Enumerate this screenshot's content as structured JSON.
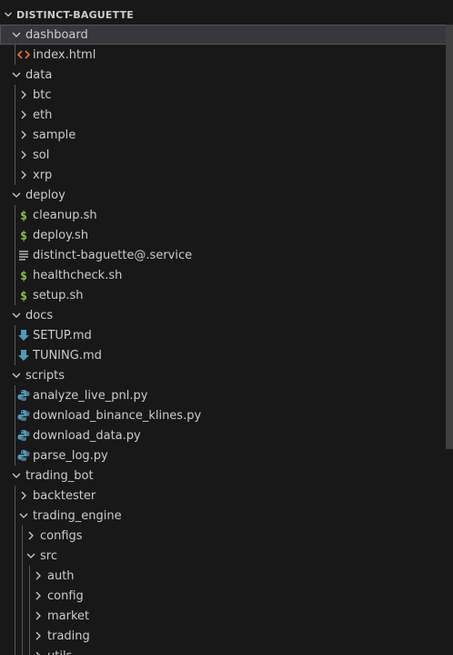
{
  "explorer": {
    "section_title": "DISTINCT-BAGUETTE",
    "tree": [
      {
        "label": "dashboard",
        "type": "folder",
        "expanded": true,
        "depth": 0,
        "selected": true
      },
      {
        "label": "index.html",
        "type": "file",
        "icon": "html-icon",
        "depth": 1
      },
      {
        "label": "data",
        "type": "folder",
        "expanded": true,
        "depth": 0
      },
      {
        "label": "btc",
        "type": "folder",
        "expanded": false,
        "depth": 1
      },
      {
        "label": "eth",
        "type": "folder",
        "expanded": false,
        "depth": 1
      },
      {
        "label": "sample",
        "type": "folder",
        "expanded": false,
        "depth": 1
      },
      {
        "label": "sol",
        "type": "folder",
        "expanded": false,
        "depth": 1
      },
      {
        "label": "xrp",
        "type": "folder",
        "expanded": false,
        "depth": 1
      },
      {
        "label": "deploy",
        "type": "folder",
        "expanded": true,
        "depth": 0
      },
      {
        "label": "cleanup.sh",
        "type": "file",
        "icon": "shell-icon",
        "depth": 1
      },
      {
        "label": "deploy.sh",
        "type": "file",
        "icon": "shell-icon",
        "depth": 1
      },
      {
        "label": "distinct-baguette@.service",
        "type": "file",
        "icon": "text-lines-icon",
        "depth": 1
      },
      {
        "label": "healthcheck.sh",
        "type": "file",
        "icon": "shell-icon",
        "depth": 1
      },
      {
        "label": "setup.sh",
        "type": "file",
        "icon": "shell-icon",
        "depth": 1
      },
      {
        "label": "docs",
        "type": "folder",
        "expanded": true,
        "depth": 0
      },
      {
        "label": "SETUP.md",
        "type": "file",
        "icon": "markdown-icon",
        "depth": 1
      },
      {
        "label": "TUNING.md",
        "type": "file",
        "icon": "markdown-icon",
        "depth": 1
      },
      {
        "label": "scripts",
        "type": "folder",
        "expanded": true,
        "depth": 0
      },
      {
        "label": "analyze_live_pnl.py",
        "type": "file",
        "icon": "python-icon",
        "depth": 1
      },
      {
        "label": "download_binance_klines.py",
        "type": "file",
        "icon": "python-icon",
        "depth": 1
      },
      {
        "label": "download_data.py",
        "type": "file",
        "icon": "python-icon",
        "depth": 1
      },
      {
        "label": "parse_log.py",
        "type": "file",
        "icon": "python-icon",
        "depth": 1
      },
      {
        "label": "trading_bot",
        "type": "folder",
        "expanded": true,
        "depth": 0
      },
      {
        "label": "backtester",
        "type": "folder",
        "expanded": false,
        "depth": 1
      },
      {
        "label": "trading_engine",
        "type": "folder",
        "expanded": true,
        "depth": 1
      },
      {
        "label": "configs",
        "type": "folder",
        "expanded": false,
        "depth": 2
      },
      {
        "label": "src",
        "type": "folder",
        "expanded": true,
        "depth": 2
      },
      {
        "label": "auth",
        "type": "folder",
        "expanded": false,
        "depth": 3
      },
      {
        "label": "config",
        "type": "folder",
        "expanded": false,
        "depth": 3
      },
      {
        "label": "market",
        "type": "folder",
        "expanded": false,
        "depth": 3
      },
      {
        "label": "trading",
        "type": "folder",
        "expanded": false,
        "depth": 3
      },
      {
        "label": "utils",
        "type": "folder",
        "expanded": false,
        "depth": 3
      }
    ]
  },
  "colors": {
    "background": "#181818",
    "selected_row": "#37373d",
    "text": "#cccccc",
    "html_icon": "#e37933",
    "shell_icon": "#8dc149",
    "markdown_icon": "#519aba",
    "python_icon": "#519aba"
  }
}
